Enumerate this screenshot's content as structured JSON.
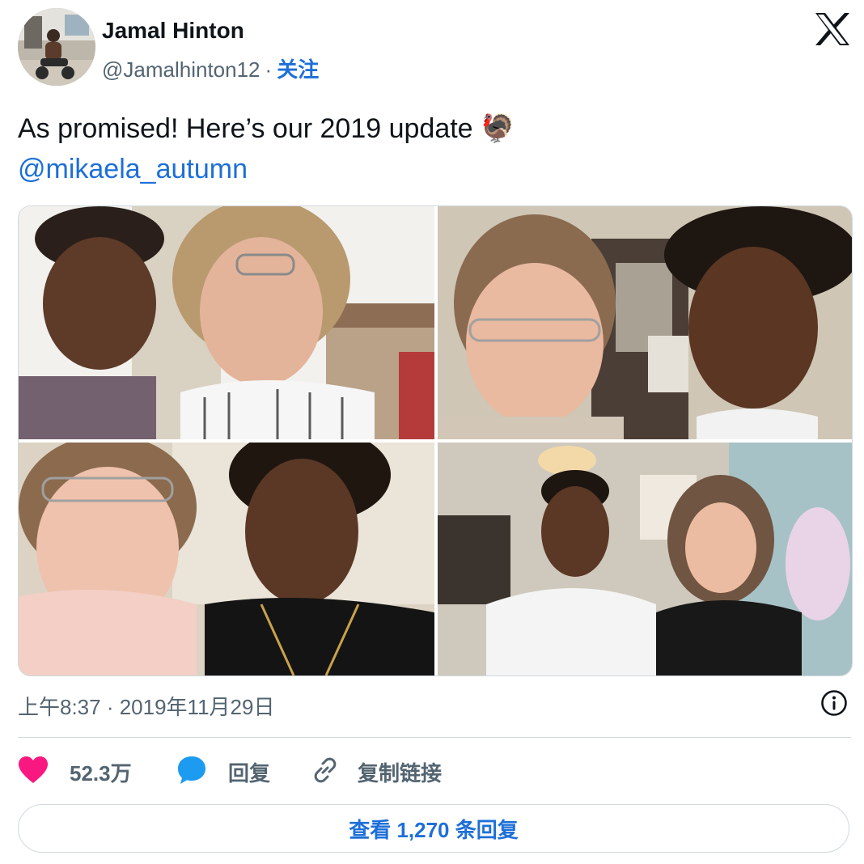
{
  "author": {
    "name": "Jamal Hinton",
    "handle": "@Jamalhinton12",
    "separator": "·",
    "follow_label": "关注"
  },
  "tweet": {
    "text": "As promised! Here’s our 2019 update",
    "emoji": "🦃",
    "mention": "@mikaela_autumn"
  },
  "media": {
    "photos": [
      {
        "name": "photo-1"
      },
      {
        "name": "photo-2"
      },
      {
        "name": "photo-3"
      },
      {
        "name": "photo-4"
      }
    ]
  },
  "meta": {
    "timestamp": "上午8:37 · 2019年11月29日"
  },
  "actions": {
    "likes": "52.3万",
    "reply_label": "回复",
    "copy_link_label": "复制链接"
  },
  "footer": {
    "view_replies_label": "查看 1,270 条回复"
  },
  "colors": {
    "accent": "#1d6fd8",
    "like": "#f91880",
    "muted": "#536471",
    "text": "#0f1419",
    "border": "#cfd9de"
  },
  "icons": {
    "brand": "x-logo-icon",
    "info": "info-icon",
    "like": "heart-icon",
    "reply": "speech-bubble-icon",
    "copy": "link-icon"
  }
}
